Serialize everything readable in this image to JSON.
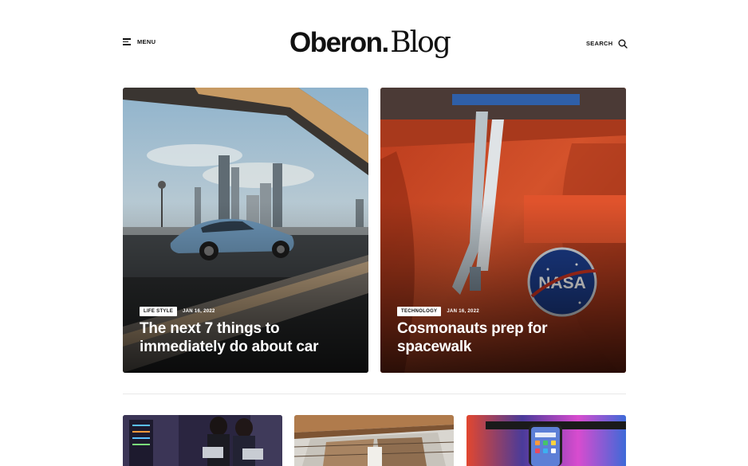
{
  "header": {
    "menu_label": "MENU",
    "logo_main": "Oberon",
    "logo_dot": ".",
    "logo_sub": "Blog",
    "search_label": "SEARCH"
  },
  "featured": [
    {
      "category": "LIFE STYLE",
      "date": "JAN 16, 2022",
      "title": "The next 7 things to immediately do about car",
      "image": "sports-car-city-skyline"
    },
    {
      "category": "TECHNOLOGY",
      "date": "JAN 16, 2022",
      "title": "Cosmonauts prep for spacewalk",
      "image": "orange-space-suit-nasa-patch"
    }
  ],
  "thumbnails": [
    {
      "image": "two-women-server-room"
    },
    {
      "image": "vessel-staircase-structure"
    },
    {
      "image": "smartphone-colorful-background"
    }
  ],
  "colors": {
    "background": "#ffffff",
    "text": "#111111",
    "divider": "#e8e8e8",
    "badge_bg": "#ffffff"
  }
}
